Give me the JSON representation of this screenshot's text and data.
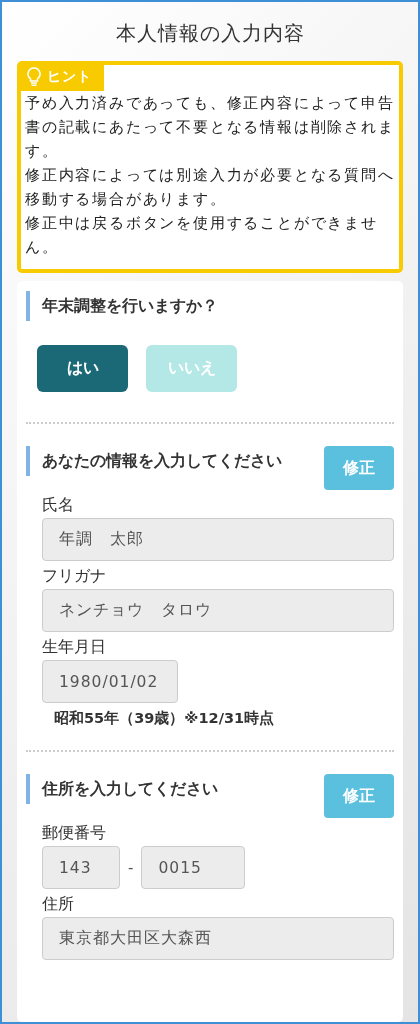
{
  "title": "本人情報の入力内容",
  "hint": {
    "label": "ヒント",
    "paragraphs": [
      "予め入力済みであっても、修正内容によって申告書の記載にあたって不要となる情報は削除されます。",
      "修正内容によっては別途入力が必要となる質問へ移動する場合があります。",
      "修正中は戻るボタンを使用することができません。"
    ]
  },
  "sections": [
    {
      "kind": "choice",
      "heading": "年末調整を行いますか？",
      "options": [
        {
          "label": "はい",
          "selected": true
        },
        {
          "label": "いいえ",
          "selected": false
        }
      ]
    },
    {
      "kind": "form",
      "heading": "あなたの情報を入力してください",
      "edit_button": "修正",
      "fields": [
        {
          "kind": "text",
          "label": "氏名",
          "value": "年調　太郎"
        },
        {
          "kind": "text",
          "label": "フリガナ",
          "value": "ネンチョウ　タロウ"
        },
        {
          "kind": "date",
          "label": "生年月日",
          "value": "1980/01/02",
          "note": "昭和55年（39歳）※12/31時点"
        }
      ]
    },
    {
      "kind": "form",
      "heading": "住所を入力してください",
      "edit_button": "修正",
      "fields": [
        {
          "kind": "postal",
          "label": "郵便番号",
          "values": [
            "143",
            "0015"
          ],
          "separator": "-"
        },
        {
          "kind": "text",
          "label": "住所",
          "value": "東京都大田区大森西"
        }
      ]
    }
  ]
}
